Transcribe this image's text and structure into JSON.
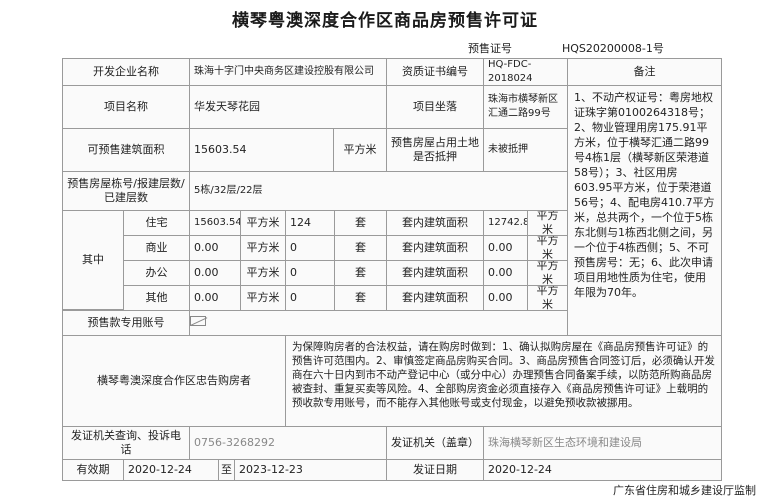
{
  "title": "横琴粤澳深度合作区商品房预售许可证",
  "certificate": {
    "label": "预售证号",
    "number": "HQS20200008-1号"
  },
  "developer": {
    "label": "开发企业名称",
    "value": "珠海十字门中央商务区建设控股有限公司"
  },
  "qualification": {
    "label": "资质证书编号",
    "value": "HQ-FDC-2018024"
  },
  "remark_label": "备注",
  "project": {
    "label": "项目名称",
    "value": "华发天琴花园",
    "location_label": "项目坐落",
    "location": "珠海市横琴新区汇通二路99号"
  },
  "presale_area": {
    "label": "可预售建筑面积",
    "value": "15603.54",
    "unit": "平方米"
  },
  "land_mortgage": {
    "label": "预售房屋占用土地是否抵押",
    "value": "未被抵押"
  },
  "buildings": {
    "label": "预售房屋栋号/报建层数/已建层数",
    "value": "5栋/32层/22层"
  },
  "breakdown": {
    "label": "其中",
    "unit_area": "平方米",
    "unit_count": "套",
    "inner_label": "套内建筑面积",
    "rows": [
      {
        "type": "住宅",
        "area": "15603.54",
        "count": "124",
        "inner": "12742.8("
      },
      {
        "type": "商业",
        "area": "0.00",
        "count": "0",
        "inner": "0.00"
      },
      {
        "type": "办公",
        "area": "0.00",
        "count": "0",
        "inner": "0.00"
      },
      {
        "type": "其他",
        "area": "0.00",
        "count": "0",
        "inner": "0.00"
      }
    ]
  },
  "account": {
    "label": "预售款专用账号"
  },
  "notice": {
    "label": "横琴粤澳深度合作区忠告购房者",
    "text": "为保障购房者的合法权益，请在购房时做到：1、确认拟购房屋在《商品房预售许可证》的预售许可范围内。2、审慎签定商品房购买合同。3、商品房预售合同签订后，必须确认开发商在六十日内到市不动产登记中心（或分中心）办理预售合同备案手续，以防范所购商品房被查封、重复买卖等风险。4、全部购房资金必须直接存入《商品房预售许可证》上载明的预收款专用账号，而不能存入其他账号或支付现金，以避免预收款被挪用。"
  },
  "remarks": "1、不动产权证号：粤房地权证珠字第0100264318号；2、物业管理用房175.91平方米，位于横琴汇通二路99号4栋1层（横琴新区荣港道58号）；3、社区用房603.95平方米，位于荣港道56号；4、配电房410.7平方米，总共两个，一个位于5栋东北侧与1栋西北侧之间，另一个位于4栋西侧；5、不可预售房号：无；6、此次申请项目用地性质为住宅，使用年限为70年。",
  "complaint": {
    "label": "发证机关查询、投诉电话",
    "value": "0756-3268292"
  },
  "issuer": {
    "label": "发证机关（盖章）",
    "value": "珠海横琴新区生态环境和建设局"
  },
  "validity": {
    "label": "有效期",
    "from": "2020-12-24",
    "to_label": "至",
    "to": "2023-12-23"
  },
  "issue_date": {
    "label": "发证日期",
    "value": "2020-12-24"
  },
  "footer": "广东省住房和城乡建设厅监制"
}
